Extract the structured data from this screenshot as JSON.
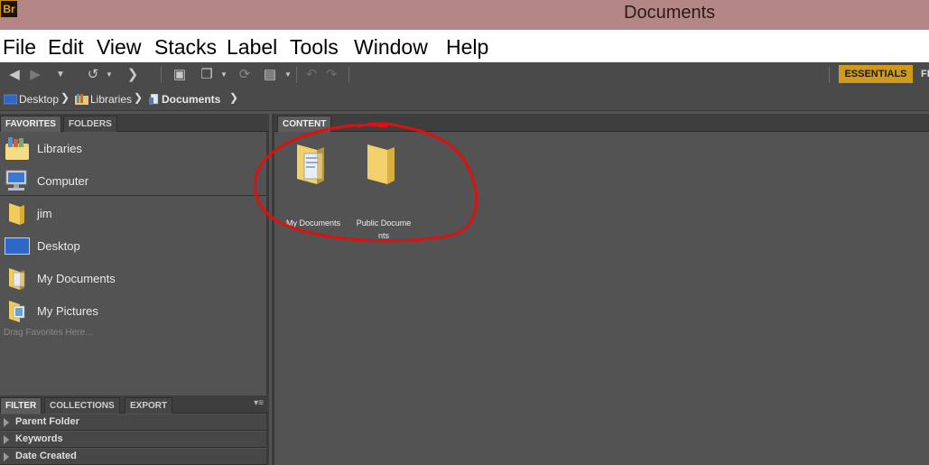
{
  "window": {
    "app_badge": "Br",
    "title": "Documents"
  },
  "menu": [
    "File",
    "Edit",
    "View",
    "Stacks",
    "Label",
    "Tools",
    "Window",
    "Help"
  ],
  "toolbar": {
    "workspace_active": "ESSENTIALS",
    "workspace_next": "FI"
  },
  "breadcrumb": [
    "Desktop",
    "Libraries",
    "Documents"
  ],
  "left_tabs": [
    "FAVORITES",
    "FOLDERS"
  ],
  "favorites": [
    "Libraries",
    "Computer",
    "jim",
    "Desktop",
    "My Documents",
    "My Pictures"
  ],
  "favorites_hint": "Drag Favorites Here...",
  "bottom_tabs": [
    "FILTER",
    "COLLECTIONS",
    "EXPORT"
  ],
  "filter_rows": [
    "Parent Folder",
    "Keywords",
    "Date Created"
  ],
  "content_tab": "CONTENT",
  "content_items": [
    {
      "label": "My Documents"
    },
    {
      "label_line1": "Public Docume",
      "label_line2": "nts"
    }
  ],
  "colors": {
    "accent": "#d09a1c",
    "titlebar": "#b48686",
    "annotation": "#e01010"
  },
  "icons": [
    "back-icon",
    "forward-icon",
    "history-icon",
    "boomerang-icon",
    "camera-icon",
    "copy-icon",
    "refresh-icon",
    "open-icon",
    "rotate-left-icon",
    "rotate-right-icon"
  ]
}
